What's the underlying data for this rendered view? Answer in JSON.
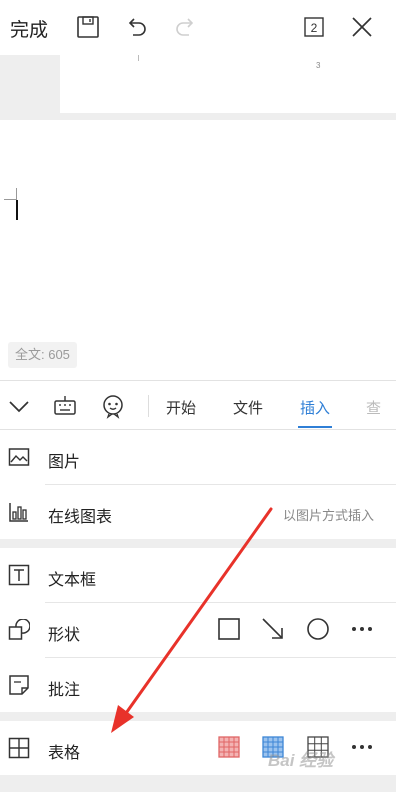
{
  "topbar": {
    "done_label": "完成",
    "page_count": "2",
    "icons": [
      "save-icon",
      "undo-icon",
      "redo-icon",
      "page-count-icon",
      "close-icon"
    ]
  },
  "preview": {
    "page_number": "3"
  },
  "editor": {
    "word_count": "全文: 605"
  },
  "toolbar": {
    "icons": [
      "collapse-icon",
      "keyboard-icon",
      "voice-assistant-icon"
    ],
    "tabs": [
      {
        "label": "开始",
        "active": false
      },
      {
        "label": "文件",
        "active": false
      },
      {
        "label": "插入",
        "active": true
      },
      {
        "label": "查",
        "active": false
      }
    ],
    "accent_color": "#2f7fd6"
  },
  "insert_menu": {
    "picture": {
      "label": "图片",
      "icon": "picture-icon"
    },
    "online_chart": {
      "label": "在线图表",
      "icon": "bar-chart-icon",
      "hint": "以图片方式插入"
    },
    "textbox": {
      "label": "文本框",
      "icon": "textbox-icon"
    },
    "shape": {
      "label": "形状",
      "icon": "shape-icon",
      "options": [
        "square-icon",
        "arrow-line-icon",
        "circle-icon",
        "more-icon"
      ]
    },
    "comment": {
      "label": "批注",
      "icon": "comment-icon"
    },
    "table": {
      "label": "表格",
      "icon": "table-icon",
      "styles": [
        "red-table-style",
        "blue-table-style",
        "plain-table-style",
        "more-icon"
      ]
    }
  },
  "watermark": "Bai 经验"
}
